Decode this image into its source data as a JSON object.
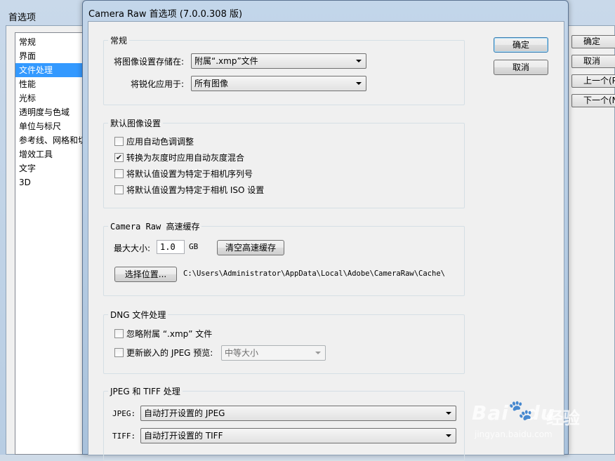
{
  "background_window": {
    "title": "首选项",
    "categories": [
      {
        "label": "常规",
        "selected": false
      },
      {
        "label": "界面",
        "selected": false
      },
      {
        "label": "文件处理",
        "selected": true
      },
      {
        "label": "性能",
        "selected": false
      },
      {
        "label": "光标",
        "selected": false
      },
      {
        "label": "透明度与色域",
        "selected": false
      },
      {
        "label": "单位与标尺",
        "selected": false
      },
      {
        "label": "参考线、网格和切",
        "selected": false
      },
      {
        "label": "增效工具",
        "selected": false
      },
      {
        "label": "文字",
        "selected": false
      },
      {
        "label": "3D",
        "selected": false
      }
    ],
    "buttons": {
      "ok": "确定",
      "cancel": "取消",
      "prev": "上一个(P",
      "next": "下一个(N"
    }
  },
  "dialog": {
    "title": "Camera Raw 首选项 (7.0.0.308 版)",
    "ok_button": "确定",
    "cancel_button": "取消",
    "general": {
      "legend": "常规",
      "save_settings_label": "将图像设置存储在:",
      "save_settings_value": "附属“.xmp”文件",
      "sharpen_label": "将锐化应用于:",
      "sharpen_value": "所有图像"
    },
    "default_settings": {
      "legend": "默认图像设置",
      "options": [
        {
          "label": "应用自动色调调整",
          "checked": false
        },
        {
          "label": "转换为灰度时应用自动灰度混合",
          "checked": true
        },
        {
          "label": "将默认值设置为特定于相机序列号",
          "checked": false
        },
        {
          "label": "将默认值设置为特定于相机 ISO 设置",
          "checked": false
        }
      ]
    },
    "cache": {
      "legend": "Camera Raw 高速缓存",
      "max_size_label": "最大大小:",
      "max_size_value": "1.0",
      "unit": "GB",
      "purge_button": "清空高速缓存",
      "select_location_button": "选择位置...",
      "path": "C:\\Users\\Administrator\\AppData\\Local\\Adobe\\CameraRaw\\Cache\\"
    },
    "dng": {
      "legend": "DNG 文件处理",
      "ignore_sidecar_label": "忽略附属 “.xmp” 文件",
      "ignore_sidecar_checked": false,
      "update_preview_label": "更新嵌入的 JPEG 预览:",
      "update_preview_checked": false,
      "preview_size_value": "中等大小"
    },
    "jpeg_tiff": {
      "legend": "JPEG 和 TIFF 处理",
      "jpeg_label": "JPEG:",
      "jpeg_value": "自动打开设置的 JPEG",
      "tiff_label": "TIFF:",
      "tiff_value": "自动打开设置的 TIFF"
    }
  },
  "watermark": {
    "logo": "Bai",
    "logo_tail": "du",
    "service": "经验",
    "url": "jingyan.baidu.com"
  }
}
